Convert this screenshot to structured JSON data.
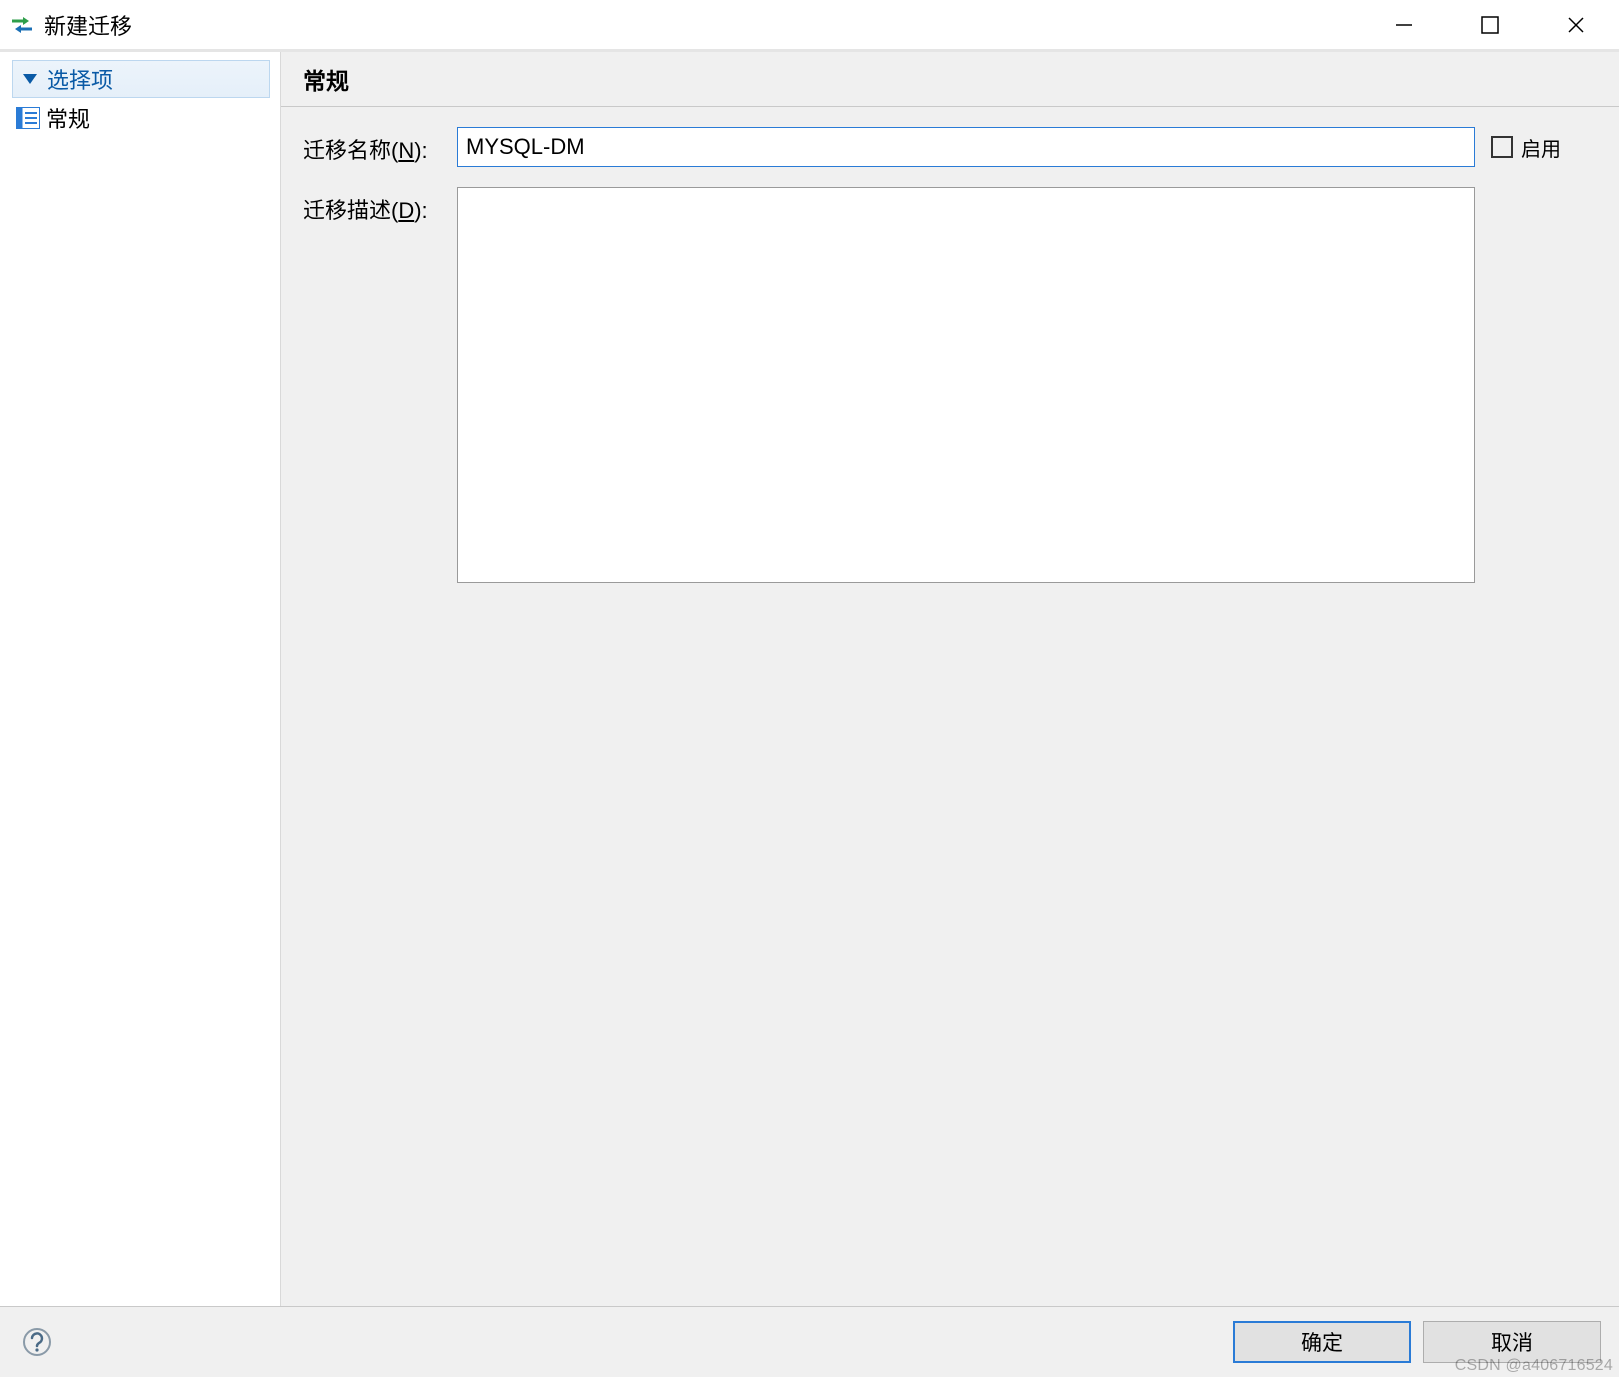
{
  "titlebar": {
    "title": "新建迁移"
  },
  "sidebar": {
    "section_label": "选择项",
    "items": [
      {
        "label": "常规"
      }
    ]
  },
  "panel": {
    "header": "常规",
    "name_label_pre": "迁移名称(",
    "name_label_u": "N",
    "name_label_post": "):",
    "name_value": "MYSQL-DM",
    "enable_label": "启用",
    "enable_checked": false,
    "desc_label_pre": "迁移描述(",
    "desc_label_u": "D",
    "desc_label_post": "):",
    "desc_value": ""
  },
  "footer": {
    "ok_label": "确定",
    "cancel_label": "取消"
  },
  "watermark": "CSDN @a406716524"
}
